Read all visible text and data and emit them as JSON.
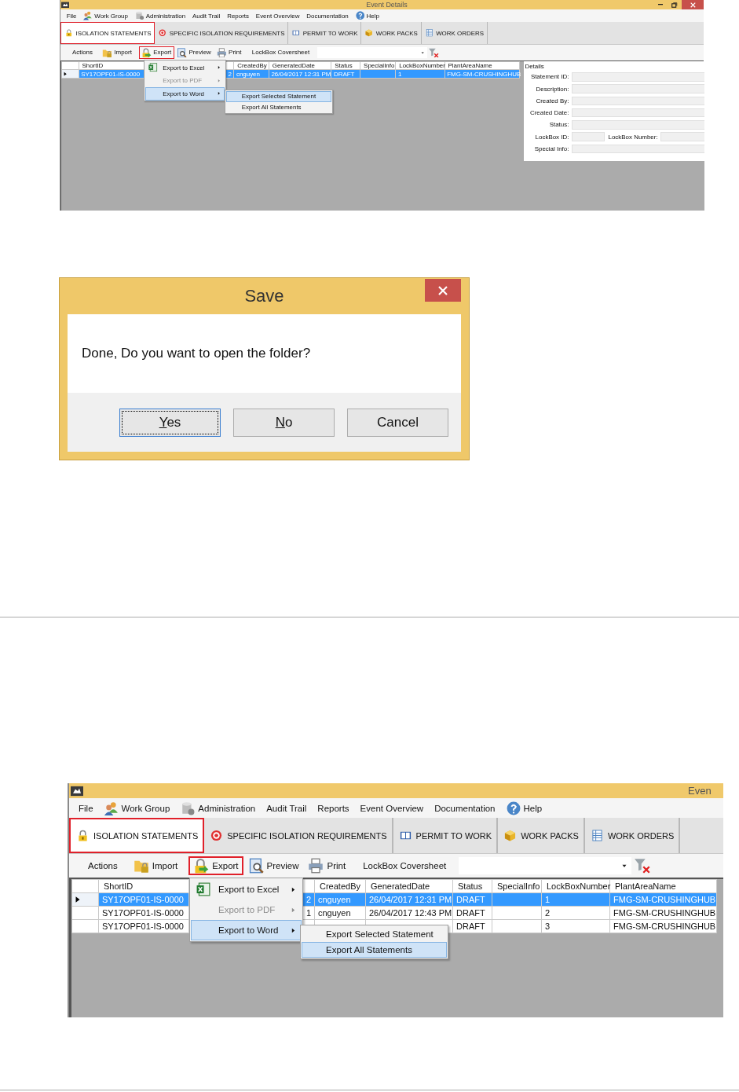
{
  "top_screenshot": {
    "window_title": "Event Details",
    "window_buttons": true,
    "menu": [
      "File",
      "Work Group",
      "Administration",
      "Audit Trail",
      "Reports",
      "Event Overview",
      "Documentation",
      "Help"
    ],
    "tabs": [
      {
        "label": "ISOLATION STATEMENTS",
        "selected": true,
        "highlighted": true
      },
      {
        "label": "SPECIFIC ISOLATION REQUIREMENTS",
        "selected": false,
        "highlighted": false
      },
      {
        "label": "PERMIT TO WORK",
        "selected": false,
        "highlighted": false
      },
      {
        "label": "WORK PACKS",
        "selected": false,
        "highlighted": false
      },
      {
        "label": "WORK ORDERS",
        "selected": false,
        "highlighted": false
      }
    ],
    "toolbar": [
      {
        "label": "Actions",
        "highlighted": false
      },
      {
        "label": "Import",
        "highlighted": false
      },
      {
        "label": "Export",
        "highlighted": true
      },
      {
        "label": "Preview",
        "highlighted": false
      },
      {
        "label": "Print",
        "highlighted": false
      },
      {
        "label": "LockBox Coversheet",
        "highlighted": false
      }
    ],
    "grid": {
      "columns": [
        "ShortID",
        null,
        "CreatedBy",
        "GeneratedDate",
        "Status",
        "SpecialInfo",
        "LockBoxNumber",
        "PlantAreaName"
      ],
      "rows": [
        {
          "selected": true,
          "current": true,
          "cells": [
            "SY17OPF01-IS-0000",
            "2",
            "cnguyen",
            "26/04/2017 12:31 PM",
            "DRAFT",
            null,
            "1",
            "FMG-SM-CRUSHINGHUB"
          ]
        }
      ]
    },
    "context_menu": [
      {
        "label": "Export to Excel",
        "selected": false,
        "disabled": false,
        "has_submenu": true
      },
      {
        "label": "Export to PDF",
        "selected": false,
        "disabled": true,
        "has_submenu": true
      },
      {
        "label": "Export to Word",
        "selected": true,
        "disabled": false,
        "has_submenu": true
      }
    ],
    "submenu": [
      {
        "label": "Export Selected Statement",
        "selected": true
      },
      {
        "label": "Export All Statements",
        "selected": false
      }
    ],
    "details": {
      "title": "Details",
      "rows": [
        [
          "Statement ID:"
        ],
        [
          "Description:"
        ],
        [
          "Created By:"
        ],
        [
          "Created Date:"
        ],
        [
          "Status:"
        ],
        [
          "LockBox ID:",
          "LockBox Number:"
        ],
        [
          "Special Info:"
        ]
      ]
    }
  },
  "dialog": {
    "title": "Save",
    "message": "Done, Do you want to open the folder?",
    "buttons": [
      {
        "label": "Yes",
        "focused": true,
        "access_key": true
      },
      {
        "label": "No",
        "focused": false,
        "access_key": true
      },
      {
        "label": "Cancel",
        "focused": false,
        "access_key": false
      }
    ]
  },
  "bottom_screenshot": {
    "window_title": "Even",
    "menu": [
      "File",
      "Work Group",
      "Administration",
      "Audit Trail",
      "Reports",
      "Event Overview",
      "Documentation",
      "Help"
    ],
    "tabs": [
      {
        "label": "ISOLATION STATEMENTS",
        "selected": true,
        "highlighted": true
      },
      {
        "label": "SPECIFIC ISOLATION REQUIREMENTS",
        "selected": false,
        "highlighted": false
      },
      {
        "label": "PERMIT TO WORK",
        "selected": false,
        "highlighted": false
      },
      {
        "label": "WORK PACKS",
        "selected": false,
        "highlighted": false
      },
      {
        "label": "WORK ORDERS",
        "selected": false,
        "highlighted": false
      }
    ],
    "toolbar": [
      {
        "label": "Actions",
        "highlighted": false
      },
      {
        "label": "Import",
        "highlighted": false
      },
      {
        "label": "Export",
        "highlighted": true
      },
      {
        "label": "Preview",
        "highlighted": false
      },
      {
        "label": "Print",
        "highlighted": false
      },
      {
        "label": "LockBox Coversheet",
        "highlighted": false
      }
    ],
    "grid": {
      "columns": [
        "ShortID",
        null,
        "CreatedBy",
        "GeneratedDate",
        "Status",
        "SpecialInfo",
        "LockBoxNumber",
        "PlantAreaName"
      ],
      "rows": [
        {
          "selected": true,
          "current": true,
          "cells": [
            "SY17OPF01-IS-0000",
            "2",
            "cnguyen",
            "26/04/2017 12:31 PM",
            "DRAFT",
            null,
            "1",
            "FMG-SM-CRUSHINGHUB"
          ]
        },
        {
          "selected": false,
          "current": false,
          "cells": [
            "SY17OPF01-IS-0000",
            "1",
            "cnguyen",
            "26/04/2017 12:43 PM",
            "DRAFT",
            null,
            "2",
            "FMG-SM-CRUSHINGHUB"
          ]
        },
        {
          "selected": false,
          "current": false,
          "cells": [
            "SY17OPF01-IS-0000",
            null,
            null,
            null,
            "DRAFT",
            null,
            "3",
            "FMG-SM-CRUSHINGHUB"
          ]
        }
      ]
    },
    "context_menu": [
      {
        "label": "Export to Excel",
        "selected": false,
        "disabled": false,
        "has_submenu": true
      },
      {
        "label": "Export to PDF",
        "selected": false,
        "disabled": true,
        "has_submenu": true
      },
      {
        "label": "Export to Word",
        "selected": true,
        "disabled": false,
        "has_submenu": true
      }
    ],
    "submenu": [
      {
        "label": "Export Selected Statement",
        "selected": false
      },
      {
        "label": "Export All Statements",
        "selected": true
      }
    ]
  }
}
